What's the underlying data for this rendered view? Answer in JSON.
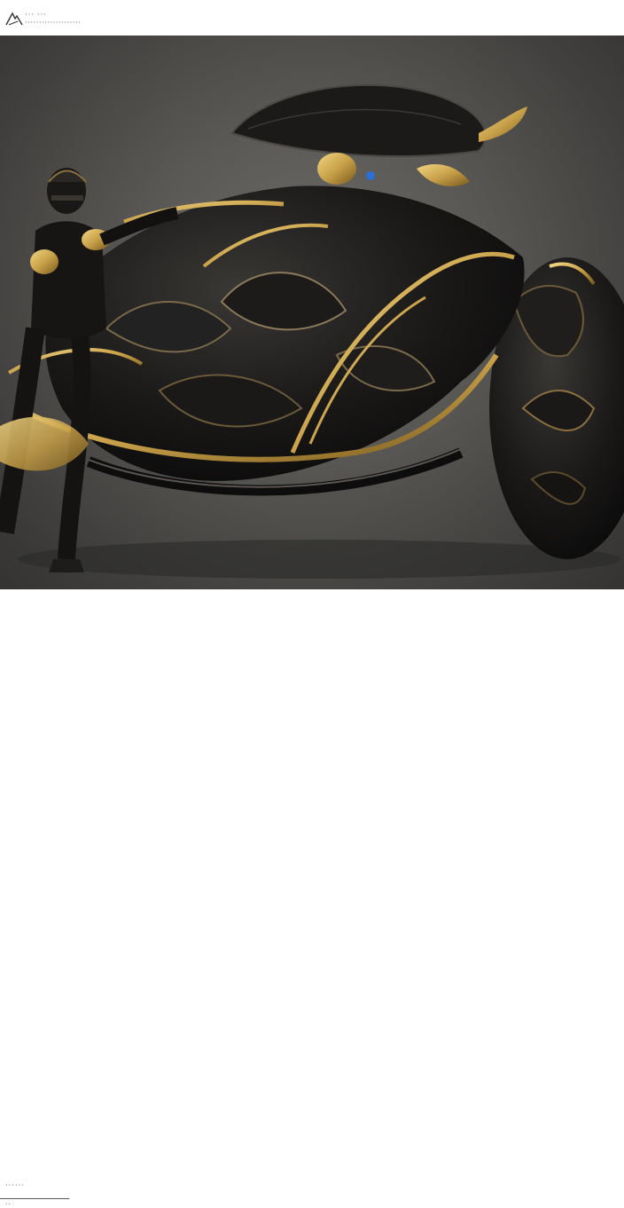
{
  "header": {
    "logo_icon": "mountain-logo-icon",
    "logo_line1": "··· ···",
    "logo_line2": "····················"
  },
  "photo": {
    "colors": {
      "background": "#5a5855",
      "metal_black": "#141312",
      "gold": "#c9a24a"
    }
  },
  "footer": {
    "caption_line1": "······",
    "caption_line2": "··"
  }
}
